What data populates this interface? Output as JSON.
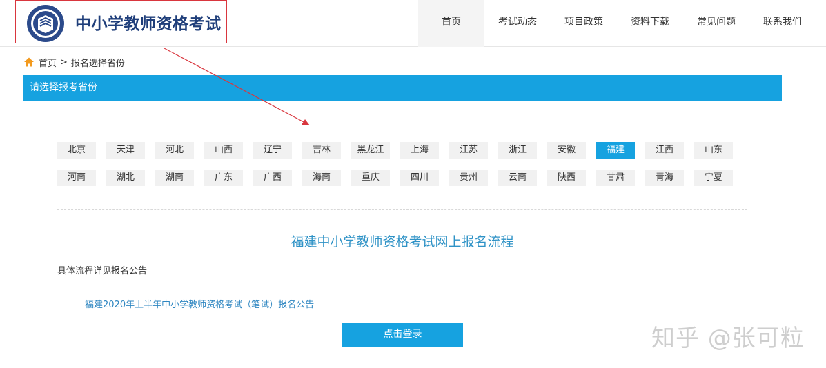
{
  "header": {
    "logo_title": "中小学教师资格考试",
    "nav": [
      {
        "label": "首页",
        "active": true
      },
      {
        "label": "考试动态",
        "active": false
      },
      {
        "label": "项目政策",
        "active": false
      },
      {
        "label": "资料下载",
        "active": false
      },
      {
        "label": "常见问题",
        "active": false
      },
      {
        "label": "联系我们",
        "active": false
      }
    ]
  },
  "breadcrumb": {
    "icon": "home-icon",
    "home": "首页",
    "separator": ">",
    "current": "报名选择省份"
  },
  "title_bar": "请选择报考省份",
  "provinces": {
    "row1": [
      "北京",
      "天津",
      "河北",
      "山西",
      "辽宁",
      "吉林",
      "黑龙江",
      "上海",
      "江苏",
      "浙江",
      "安徽",
      "福建",
      "江西",
      "山东"
    ],
    "row2": [
      "河南",
      "湖北",
      "湖南",
      "广东",
      "广西",
      "海南",
      "重庆",
      "四川",
      "贵州",
      "云南",
      "陕西",
      "甘肃",
      "青海",
      "宁夏"
    ],
    "selected": "福建"
  },
  "flow_title": "福建中小学教师资格考试网上报名流程",
  "detail_text": "具体流程详见报名公告",
  "notice_link": "福建2020年上半年中小学教师资格考试（笔试）报名公告",
  "login_button": "点击登录",
  "watermark": "知乎 @张可粒",
  "colors": {
    "accent": "#16a2e0",
    "logo_title": "#1f3e7a",
    "highlight_box": "#d9363e",
    "annotation_arrow": "#d9363e"
  }
}
